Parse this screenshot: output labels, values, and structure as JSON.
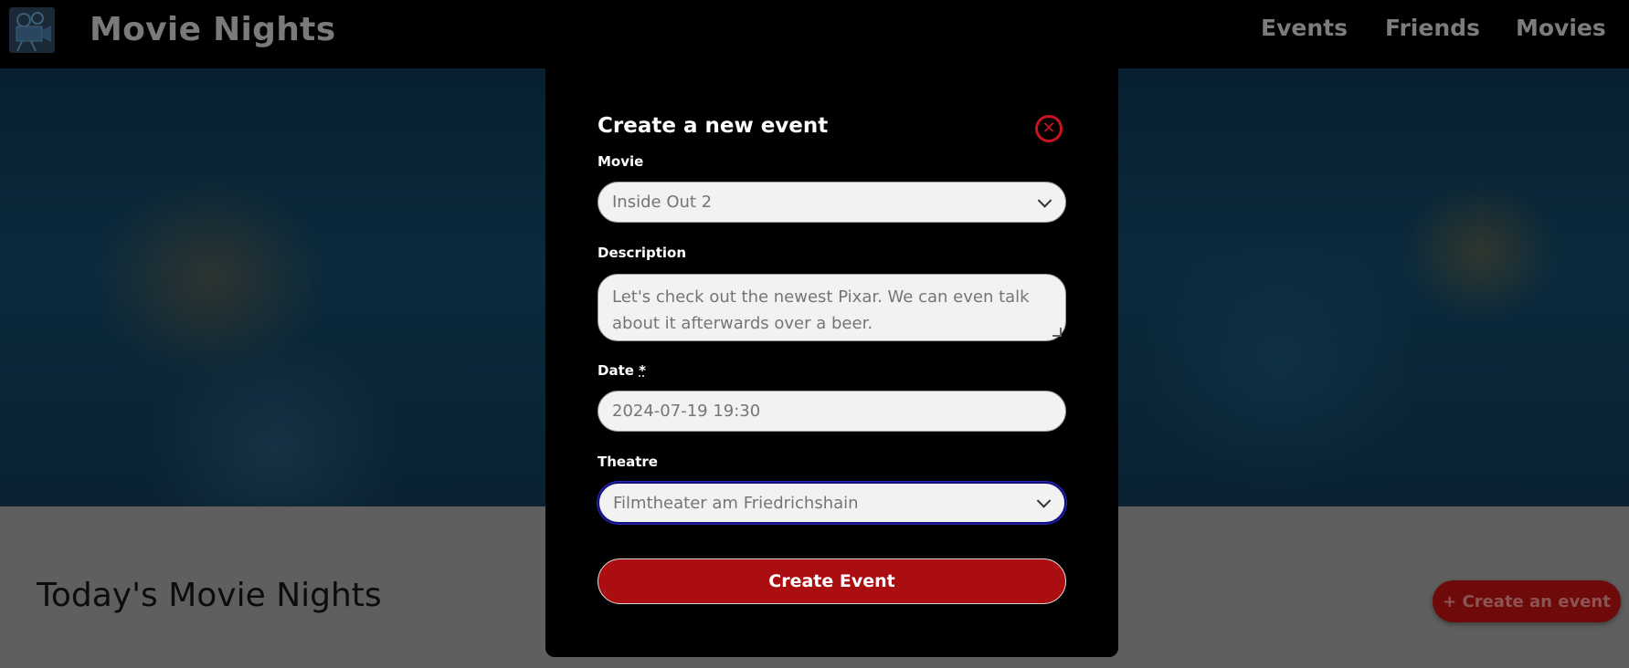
{
  "header": {
    "site_title": "Movie Nights",
    "nav": {
      "events": "Events",
      "friends": "Friends",
      "movies": "Movies"
    }
  },
  "main": {
    "section_title": "Today's Movie Nights",
    "create_button": "+ Create an event"
  },
  "modal": {
    "title": "Create a new event",
    "close_icon": "close-icon",
    "movie_label": "Movie",
    "movie_value": "Inside Out 2",
    "description_label": "Description",
    "description_value": "Let's check out the newest Pixar. We can even talk about it afterwards over a beer.",
    "date_label": "Date",
    "date_required_marker": "*",
    "date_value": "2024-07-19 19:30",
    "theatre_label": "Theatre",
    "theatre_value": "Filmtheater am Friedrichshain",
    "submit_label": "Create Event"
  },
  "colors": {
    "accent": "#ab0e10",
    "close": "#c8141e",
    "focus": "#101080"
  }
}
